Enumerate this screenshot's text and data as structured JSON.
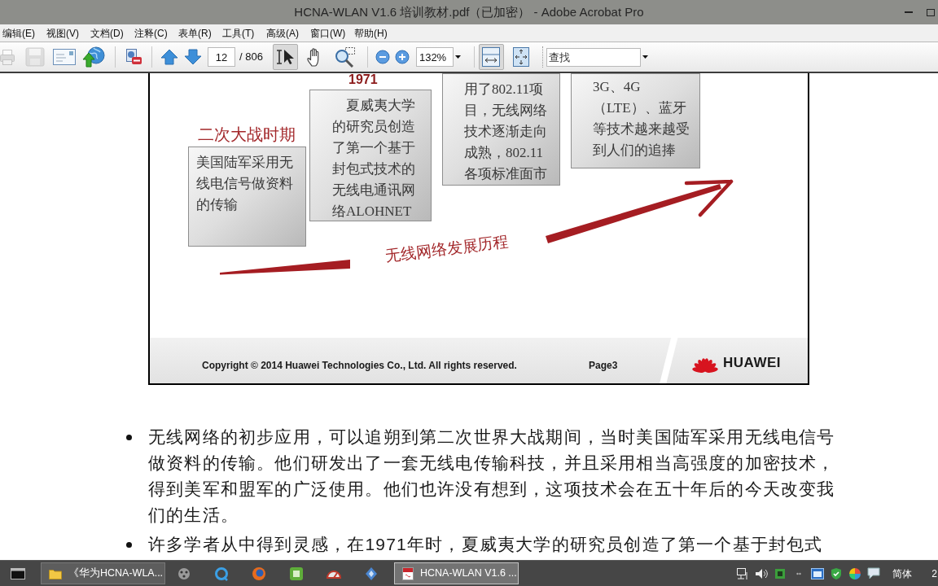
{
  "window": {
    "title": "HCNA-WLAN V1.6 培训教材.pdf（已加密） - Adobe Acrobat Pro"
  },
  "menu": [
    "编辑(E)",
    "视图(V)",
    "文档(D)",
    "注释(C)",
    "表单(R)",
    "工具(T)",
    "高级(A)",
    "窗口(W)",
    "帮助(H)"
  ],
  "toolbar": {
    "file_buttons": [
      {
        "kind": "print",
        "disabled": true
      },
      {
        "kind": "save",
        "disabled": true
      },
      {
        "kind": "email",
        "disabled": false
      },
      {
        "kind": "web",
        "disabled": false
      }
    ],
    "page": {
      "value": "12",
      "total": "/ 806"
    },
    "tools": [
      {
        "kind": "select",
        "selected": true
      },
      {
        "kind": "hand",
        "selected": false
      },
      {
        "kind": "zoom",
        "selected": false
      }
    ],
    "zoom": {
      "value": "132%"
    },
    "views": [
      {
        "kind": "fit-width",
        "selected": true
      },
      {
        "kind": "fit-page",
        "selected": false
      }
    ],
    "find": {
      "placeholder": "查找"
    }
  },
  "slide": {
    "year": "1971",
    "cards": [
      {
        "heading": "二次大战时期",
        "indent": false,
        "lines": [
          "美国陆军采用无",
          "线电信号做资料",
          "的传输"
        ]
      },
      {
        "indent": true,
        "lines": [
          "夏威夷大学",
          "的研究员创造",
          "了第一个基于",
          "封包式技术的",
          "无线电通讯网",
          "络ALOHNET"
        ]
      },
      {
        "indent": false,
        "lines": [
          "用了802.11项",
          "目，无线网络",
          "技术逐渐走向",
          "成熟，802.11",
          "各项标准面市"
        ]
      },
      {
        "indent": false,
        "lines": [
          "3G、4G",
          "（LTE）、蓝牙",
          "等技术越来越受",
          "到人们的追捧"
        ]
      }
    ],
    "caption": "无线网络发展历程",
    "footer": {
      "copyright": "Copyright © 2014 Huawei Technologies Co., Ltd. All rights reserved.",
      "page": "Page3",
      "brand": "HUAWEI"
    }
  },
  "body": {
    "bullets": [
      {
        "lines": [
          "无线网络的初步应用，可以追朔到第二次世界大战期间，当时美国陆军采用无线电信号",
          "做资料的传输。他们研发出了一套无线电传输科技，并且采用相当高强度的加密技术，",
          "得到美军和盟军的广泛使用。他们也许没有想到，这项技术会在五十年后的今天改变我",
          "们的生活。"
        ]
      },
      {
        "lines": [
          "许多学者从中得到灵感，在1971年时，夏威夷大学的研究员创造了第一个基于封包式"
        ]
      }
    ]
  },
  "taskbar": {
    "windows": [
      {
        "kind": "folder",
        "label": "《华为HCNA-WLA...",
        "selected": false
      },
      {
        "kind": "pdf",
        "label": "HCNA-WLAN V1.6 ...",
        "selected": true
      }
    ],
    "ime": "简体",
    "clock": "2"
  }
}
